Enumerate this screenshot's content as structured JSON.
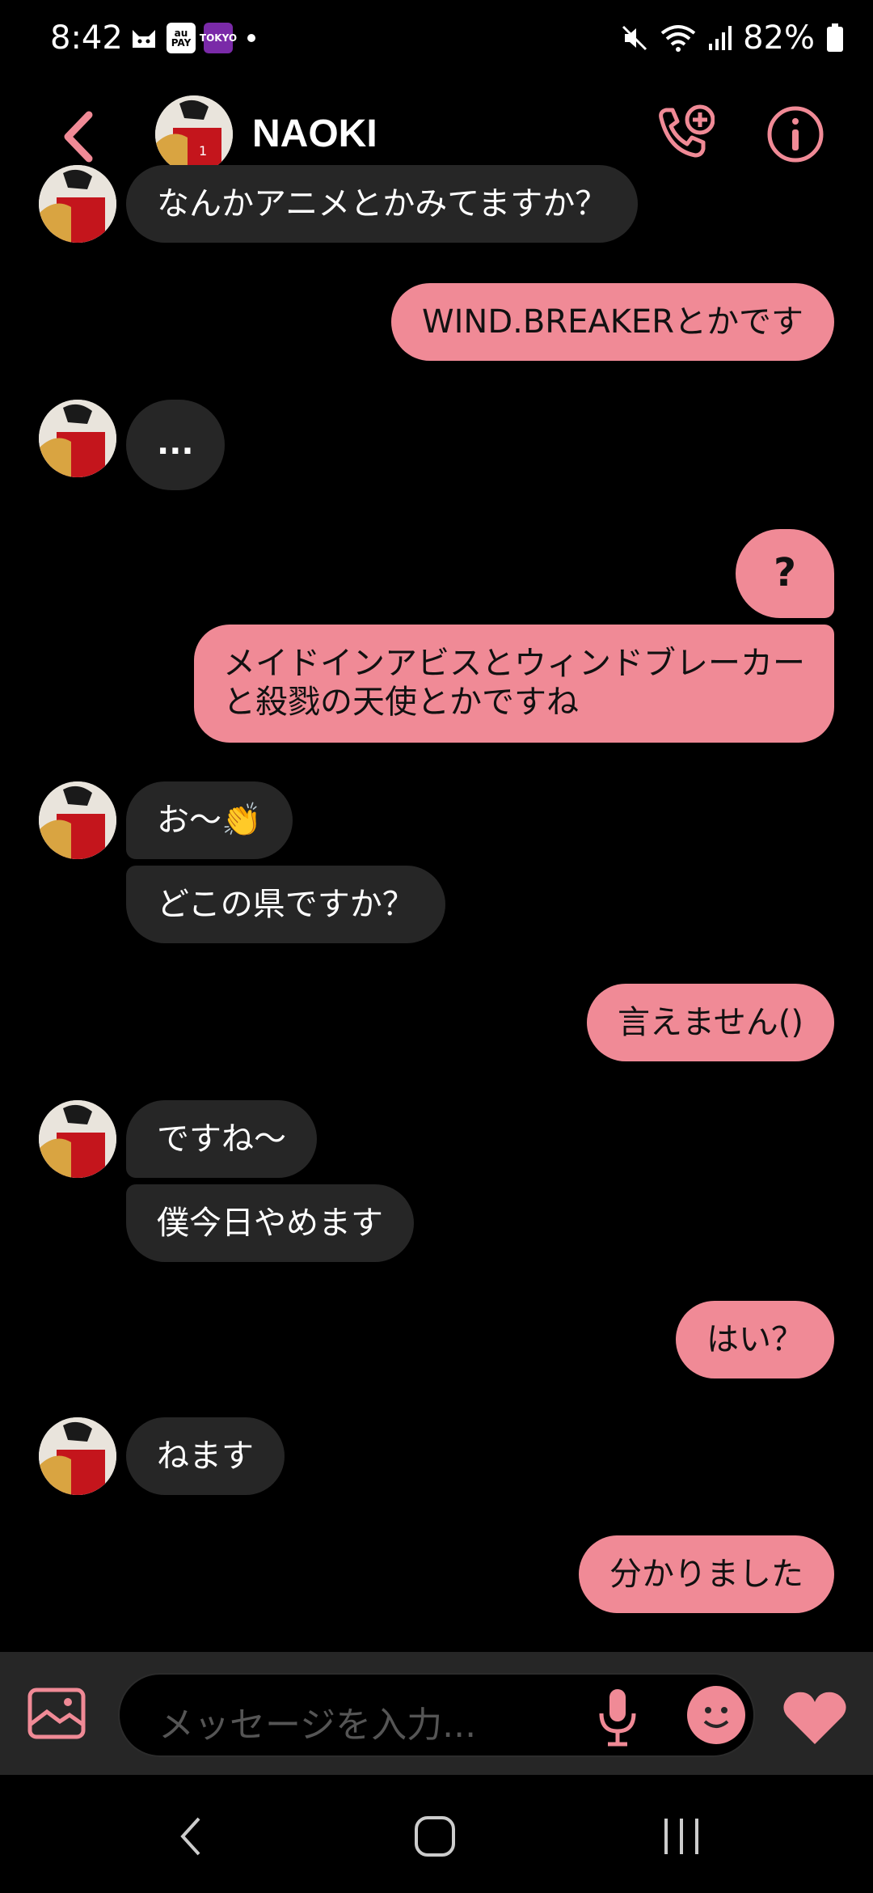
{
  "status_bar": {
    "time": "8:42",
    "notification_badges": [
      "au PAY",
      "TOKYO"
    ],
    "battery": "82%"
  },
  "header": {
    "contact_name": "NAOKI"
  },
  "messages": [
    {
      "side": "in",
      "text": "なんかアニメとかみてますか？"
    },
    {
      "side": "out",
      "text": "WIND.BREAKERとかです"
    },
    {
      "side": "in",
      "text": "..."
    },
    {
      "side": "out",
      "text": "?"
    },
    {
      "side": "out",
      "lines": [
        "メイドインアビスとウィンドブレーカー",
        "と殺戮の天使とかですね"
      ]
    },
    {
      "side": "in",
      "text": "お〜👏"
    },
    {
      "side": "in",
      "text": "どこの県ですか？"
    },
    {
      "side": "out",
      "text": "言えません()"
    },
    {
      "side": "in",
      "text": "ですね〜"
    },
    {
      "side": "in",
      "text": "僕今日やめます"
    },
    {
      "side": "out",
      "text": "はい？"
    },
    {
      "side": "in",
      "text": "ねます"
    },
    {
      "side": "out",
      "text": "分かりました"
    }
  ],
  "composer": {
    "placeholder": "メッセージを入力..."
  },
  "icons": {
    "back": "chevron-left-icon",
    "call": "phone-plus-icon",
    "info": "info-icon",
    "gallery": "image-icon",
    "mic": "microphone-icon",
    "emoji": "smile-icon",
    "heart": "heart-icon"
  },
  "colors": {
    "accent": "#f08a96",
    "incoming_bubble": "#262626",
    "background": "#000000"
  }
}
